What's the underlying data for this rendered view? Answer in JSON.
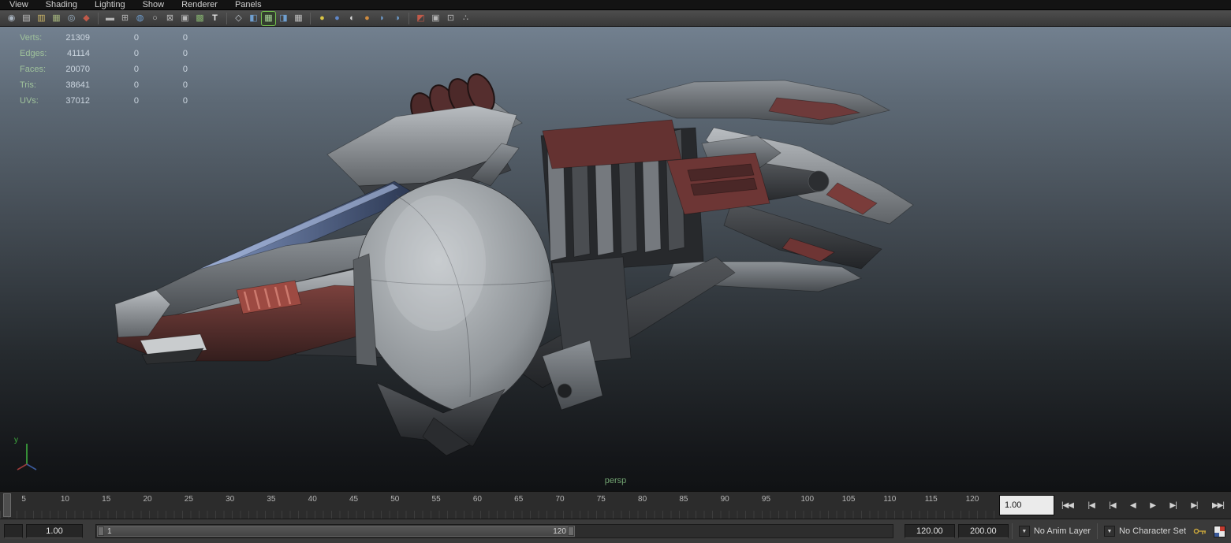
{
  "colors": {
    "hud_label": "#9fc29b",
    "hud_value": "#ccd6e0",
    "camera_label": "#72a472",
    "active_tool_outline": "#74c24e",
    "viewport_gradient_top": "#72808f",
    "viewport_gradient_bottom": "#101214",
    "axis_y": "#3fae3f"
  },
  "menubar": {
    "items": [
      {
        "label": "View",
        "name": "menu-view"
      },
      {
        "label": "Shading",
        "name": "menu-shading"
      },
      {
        "label": "Lighting",
        "name": "menu-lighting"
      },
      {
        "label": "Show",
        "name": "menu-show"
      },
      {
        "label": "Renderer",
        "name": "menu-renderer"
      },
      {
        "label": "Panels",
        "name": "menu-panels"
      }
    ]
  },
  "toolbar": {
    "icons": [
      {
        "name": "select-camera-icon",
        "glyph": "◉",
        "style": "color:#a9b4c0",
        "cls": "tbtn",
        "inter": "true"
      },
      {
        "name": "pencil-tool-icon",
        "glyph": "▤",
        "style": "color:#c2c2c2",
        "cls": "tbtn",
        "inter": "true"
      },
      {
        "name": "bookmarks-icon",
        "glyph": "▥",
        "style": "color:#cdb768",
        "cls": "tbtn",
        "inter": "true"
      },
      {
        "name": "image-plane-icon",
        "glyph": "▦",
        "style": "color:#a3b37d",
        "cls": "tbtn",
        "inter": "true"
      },
      {
        "name": "2d-pan-zoom-icon",
        "glyph": "◎",
        "style": "color:#9fb6c9",
        "cls": "tbtn",
        "inter": "true"
      },
      {
        "name": "grease-pencil-icon",
        "glyph": "◆",
        "style": "color:#c05a4a",
        "cls": "tbtn",
        "inter": "true"
      },
      {
        "name": "toolbar-separator",
        "glyph": "",
        "style": "",
        "cls": "tsep",
        "inter": "false"
      },
      {
        "name": "film-gate-icon",
        "glyph": "▬",
        "style": "color:#b5b5b5",
        "cls": "tbtn",
        "inter": "true"
      },
      {
        "name": "resolution-gate-icon",
        "glyph": "⊞",
        "style": "color:#b5b5b5",
        "cls": "tbtn",
        "inter": "true"
      },
      {
        "name": "gate-mask-icon",
        "glyph": "◍",
        "style": "color:#6f9fd0",
        "cls": "tbtn",
        "inter": "true"
      },
      {
        "name": "field-chart-icon",
        "glyph": "○",
        "style": "color:#c0c0c0",
        "cls": "tbtn",
        "inter": "true"
      },
      {
        "name": "safe-action-icon",
        "glyph": "⊠",
        "style": "color:#b5b5b5",
        "cls": "tbtn",
        "inter": "true"
      },
      {
        "name": "safe-title-icon",
        "glyph": "▣",
        "style": "color:#b5b5b5",
        "cls": "tbtn",
        "inter": "true"
      },
      {
        "name": "frame-all-icon",
        "glyph": "▩",
        "style": "color:#84b06f",
        "cls": "tbtn",
        "inter": "true"
      },
      {
        "name": "hud-toggle-icon",
        "glyph": "T",
        "style": "color:#e6e6e6;font-weight:bold",
        "cls": "tbtn",
        "inter": "true"
      },
      {
        "name": "toolbar-separator",
        "glyph": "",
        "style": "",
        "cls": "tsep",
        "inter": "false"
      },
      {
        "name": "wireframe-icon",
        "glyph": "◇",
        "style": "color:#c3cad1",
        "cls": "tbtn",
        "inter": "true"
      },
      {
        "name": "shaded-icon",
        "glyph": "◧",
        "style": "color:#6f9fd0",
        "cls": "tbtn",
        "inter": "true"
      },
      {
        "name": "textured-icon",
        "glyph": "▦",
        "style": "color:#a8d49a",
        "cls": "tbtn active",
        "inter": "true"
      },
      {
        "name": "use-default-material-icon",
        "glyph": "◨",
        "style": "color:#6f9fd0",
        "cls": "tbtn",
        "inter": "true"
      },
      {
        "name": "checkered-icon",
        "glyph": "▦",
        "style": "color:#c0c0c0",
        "cls": "tbtn",
        "inter": "true"
      },
      {
        "name": "toolbar-separator",
        "glyph": "",
        "style": "",
        "cls": "tsep",
        "inter": "false"
      },
      {
        "name": "use-all-lights-icon",
        "glyph": "●",
        "style": "color:#d9c544",
        "cls": "tbtn",
        "inter": "true"
      },
      {
        "name": "shadows-icon",
        "glyph": "●",
        "style": "color:#5f87c9",
        "cls": "tbtn",
        "inter": "true"
      },
      {
        "name": "ambient-occlusion-icon",
        "glyph": "◐",
        "style": "color:#dcdcdc",
        "cls": "tbtn",
        "inter": "true"
      },
      {
        "name": "motion-blur-icon",
        "glyph": "●",
        "style": "color:#cf8b3f",
        "cls": "tbtn",
        "inter": "true"
      },
      {
        "name": "multisampling-icon",
        "glyph": "◗",
        "style": "color:#6f9fd0",
        "cls": "tbtn",
        "inter": "true"
      },
      {
        "name": "depth-of-field-icon",
        "glyph": "◑",
        "style": "color:#6f9fd0",
        "cls": "tbtn",
        "inter": "true"
      },
      {
        "name": "toolbar-separator",
        "glyph": "",
        "style": "",
        "cls": "tsep",
        "inter": "false"
      },
      {
        "name": "isolate-select-icon",
        "glyph": "◩",
        "style": "color:#c05a4a",
        "cls": "tbtn",
        "inter": "true"
      },
      {
        "name": "x-ray-icon",
        "glyph": "▣",
        "style": "color:#b5b5b5",
        "cls": "tbtn",
        "inter": "true"
      },
      {
        "name": "joint-x-ray-icon",
        "glyph": "⊡",
        "style": "color:#b5b5b5",
        "cls": "tbtn",
        "inter": "true"
      },
      {
        "name": "plugin-shading-icon",
        "glyph": "∴",
        "style": "color:#b5b5b5",
        "cls": "tbtn",
        "inter": "true"
      }
    ]
  },
  "hud": {
    "rows": [
      {
        "label": "Verts:",
        "total": "21309",
        "col2": "0",
        "col3": "0"
      },
      {
        "label": "Edges:",
        "total": "41114",
        "col2": "0",
        "col3": "0"
      },
      {
        "label": "Faces:",
        "total": "20070",
        "col2": "0",
        "col3": "0"
      },
      {
        "label": "Tris:",
        "total": "38641",
        "col2": "0",
        "col3": "0"
      },
      {
        "label": "UVs:",
        "total": "37012",
        "col2": "0",
        "col3": "0"
      }
    ]
  },
  "viewport": {
    "camera_label": "persp",
    "axis_y_label": "y"
  },
  "timeline": {
    "ticks": [
      "5",
      "10",
      "15",
      "20",
      "25",
      "30",
      "35",
      "40",
      "45",
      "50",
      "55",
      "60",
      "65",
      "70",
      "75",
      "80",
      "85",
      "90",
      "95",
      "100",
      "105",
      "110",
      "115",
      "120"
    ],
    "current_time": "1.00"
  },
  "playback": {
    "buttons": [
      {
        "name": "go-to-start-button",
        "glyph": "|◀◀"
      },
      {
        "name": "step-back-frame-button",
        "glyph": "|◀"
      },
      {
        "name": "step-back-key-button",
        "glyph": "|◀"
      },
      {
        "name": "play-backwards-button",
        "glyph": "◀"
      },
      {
        "name": "play-forwards-button",
        "glyph": "▶"
      },
      {
        "name": "step-forward-key-button",
        "glyph": "▶|"
      },
      {
        "name": "step-forward-frame-button",
        "glyph": "▶|"
      },
      {
        "name": "go-to-end-button",
        "glyph": "▶▶|"
      }
    ]
  },
  "range_bar": {
    "playback_start": "1.00",
    "range_start": "1",
    "range_end": "120",
    "playback_end": "120.00",
    "animation_end": "200.00",
    "anim_layer": "No Anim Layer",
    "character_set": "No Character Set"
  }
}
